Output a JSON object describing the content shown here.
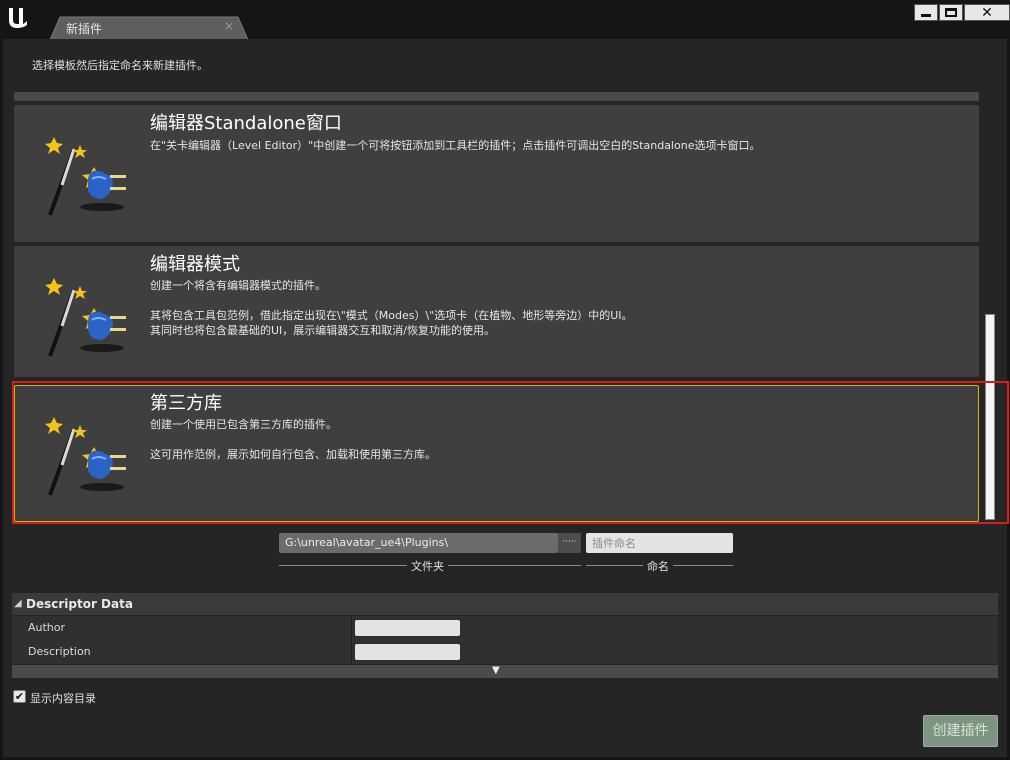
{
  "window": {
    "tab_title": "新插件",
    "tab_close": "×",
    "buttons": {
      "minimize": "minimize-icon",
      "maximize": "maximize-icon",
      "close": "✕"
    }
  },
  "subtitle": "选择模板然后指定命名来新建插件。",
  "templates": [
    {
      "title": "编辑器Standalone窗口",
      "desc_lines": [
        "在\"关卡编辑器（Level Editor）\"中创建一个可将按钮添加到工具栏的插件；点击插件可调出空白的Standalone选项卡窗口。"
      ],
      "icon": "magic-wand-plug-icon",
      "selected": false
    },
    {
      "title": "编辑器模式",
      "desc_lines": [
        "创建一个将含有编辑器模式的插件。",
        "其将包含工具包范例，借此指定出现在\\\"模式（Modes）\\\"选项卡（在植物、地形等旁边）中的UI。",
        "其同时也将包含最基础的UI，展示编辑器交互和取消/恢复功能的使用。"
      ],
      "icon": "magic-wand-plug-icon",
      "selected": false
    },
    {
      "title": "第三方库",
      "desc_lines": [
        "创建一个使用已包含第三方库的插件。",
        "这可用作范例，展示如何自行包含、加载和使用第三方库。"
      ],
      "icon": "magic-wand-plug-icon",
      "selected": true
    }
  ],
  "path": {
    "folder_value": "G:\\unreal\\avatar_ue4\\Plugins\\",
    "browse_label": "·····",
    "name_placeholder": "插件命名",
    "folder_label": "文件夹",
    "name_label": "命名"
  },
  "descriptor": {
    "header": "Descriptor Data",
    "rows": [
      {
        "name": "Author",
        "value": ""
      },
      {
        "name": "Description",
        "value": ""
      }
    ]
  },
  "show_content_dir": {
    "label": "显示内容目录",
    "checked": true
  },
  "create_button": "创建插件",
  "colors": {
    "selected_border": "#d1b800",
    "highlight_annotation": "#d91c1c",
    "create_button_bg": "#7f9583"
  }
}
